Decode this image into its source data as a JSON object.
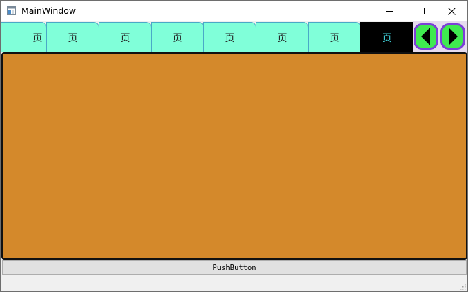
{
  "window": {
    "title": "MainWindow",
    "controls": {
      "minimize": "minimize-icon",
      "maximize": "maximize-icon",
      "close": "close-icon"
    }
  },
  "tabs": [
    {
      "label": "页",
      "selected": false
    },
    {
      "label": "页",
      "selected": false
    },
    {
      "label": "页",
      "selected": false
    },
    {
      "label": "页",
      "selected": false
    },
    {
      "label": "页",
      "selected": false
    },
    {
      "label": "页",
      "selected": false
    },
    {
      "label": "页",
      "selected": false
    },
    {
      "label": "页",
      "selected": true
    }
  ],
  "tab_scroll": {
    "left_icon": "triangle-left-icon",
    "right_icon": "triangle-right-icon"
  },
  "button": {
    "label": "PushButton"
  },
  "colors": {
    "tab_background": "#80ffd9",
    "tab_border": "#4aa9c7",
    "tab_selected_background": "#000000",
    "tab_selected_text": "#3fd0d8",
    "scroll_button_fill": "#3fea50",
    "scroll_button_border": "#7c3fd8",
    "pane_background": "#d4892b"
  }
}
